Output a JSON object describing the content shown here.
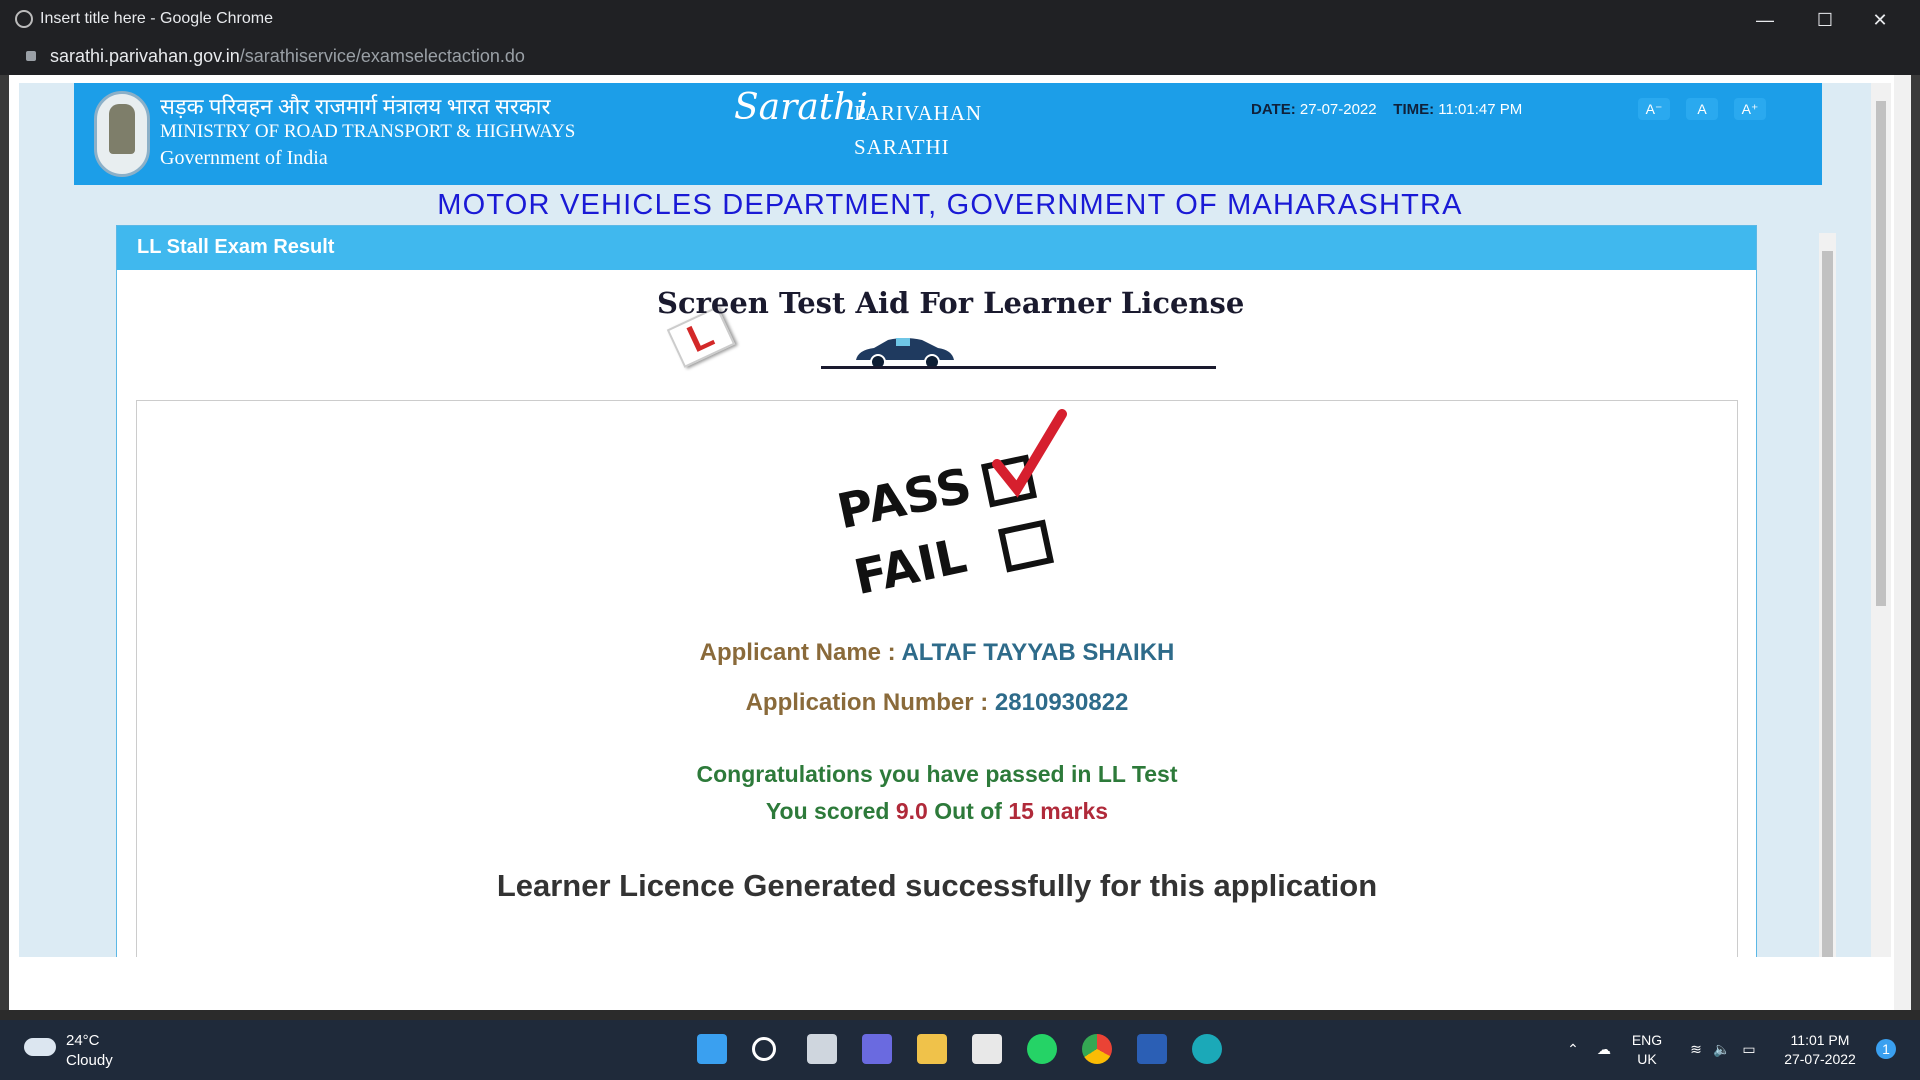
{
  "browser": {
    "title": "Insert title here - Google Chrome",
    "url_host": "sarathi.parivahan.gov.in",
    "url_path": "/sarathiservice/examselectaction.do",
    "minimize": "—",
    "maximize": "☐",
    "close": "✕"
  },
  "header": {
    "hindi": "सड़क परिवहन और राजमार्ग मंत्रालय भारत सरकार",
    "ministry": "MINISTRY OF ROAD TRANSPORT & HIGHWAYS",
    "gov": "Government of India",
    "logo_script": "Sarathi",
    "logo_line1": "PARIVAHAN",
    "logo_line2": "SARATHI",
    "date_label": "DATE:",
    "date_value": "27-07-2022",
    "time_label": "TIME:",
    "time_value": "11:01:47 PM",
    "font_small": "A⁻",
    "font_normal": "A",
    "font_large": "A⁺"
  },
  "dept": "MOTOR VEHICLES DEPARTMENT, GOVERNMENT OF MAHARASHTRA",
  "panel": {
    "heading": "LL Stall Exam Result",
    "stall_title": "Screen Test Aid For Learner License",
    "plate": "L",
    "pass": "PASS",
    "fail": "FAIL",
    "applicant_label": "Applicant Name :",
    "applicant_value": "ALTAF TAYYAB SHAIKH",
    "appno_label": "Application Number :",
    "appno_value": "2810930822",
    "congrats": "Congratulations you have passed in LL Test",
    "score_pre": "You scored",
    "score_value": "9.0",
    "score_mid": "Out of",
    "score_total": "15",
    "score_post": "marks",
    "generated": "Learner Licence Generated successfully for this application"
  },
  "taskbar": {
    "temp": "24°C",
    "weather": "Cloudy",
    "lang1": "ENG",
    "lang2": "UK",
    "clock_time": "11:01 PM",
    "clock_date": "27-07-2022",
    "notif": "1"
  }
}
